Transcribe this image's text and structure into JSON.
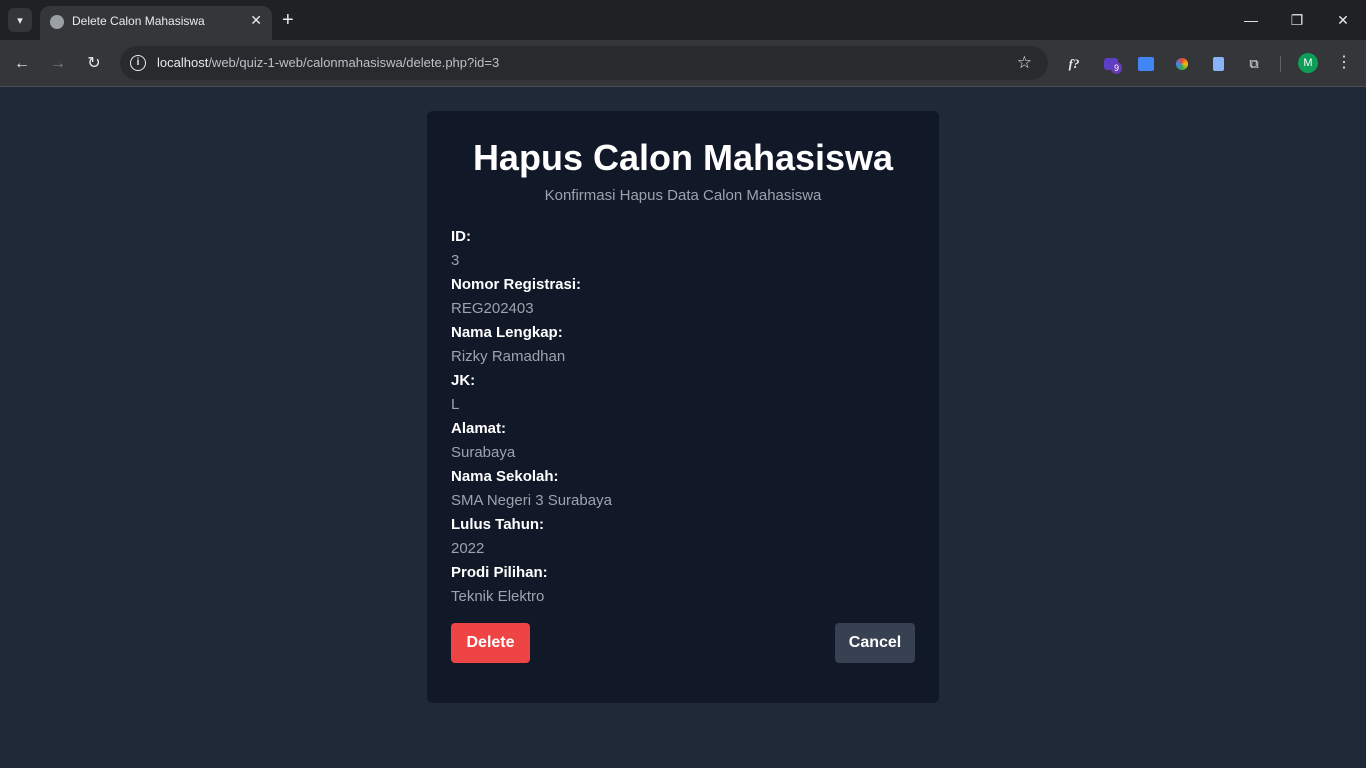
{
  "browser": {
    "tab_title": "Delete Calon Mahasiswa",
    "url_host": "localhost",
    "url_path": "/web/quiz-1-web/calonmahasiswa/delete.php?id=3",
    "extension_badge": "9",
    "profile_initial": "M",
    "function_ext_label": "f?"
  },
  "page": {
    "title": "Hapus Calon Mahasiswa",
    "subtitle": "Konfirmasi Hapus Data Calon Mahasiswa",
    "fields": [
      {
        "label": "ID:",
        "value": "3"
      },
      {
        "label": "Nomor Registrasi:",
        "value": "REG202403"
      },
      {
        "label": "Nama Lengkap:",
        "value": "Rizky Ramadhan"
      },
      {
        "label": "JK:",
        "value": "L"
      },
      {
        "label": "Alamat:",
        "value": "Surabaya"
      },
      {
        "label": "Nama Sekolah:",
        "value": "SMA Negeri 3 Surabaya"
      },
      {
        "label": "Lulus Tahun:",
        "value": "2022"
      },
      {
        "label": "Prodi Pilihan:",
        "value": "Teknik Elektro"
      }
    ],
    "delete_label": "Delete",
    "cancel_label": "Cancel"
  },
  "colors": {
    "background": "#1f2937",
    "card": "#111827",
    "delete": "#ef4444",
    "cancel": "#374151"
  }
}
